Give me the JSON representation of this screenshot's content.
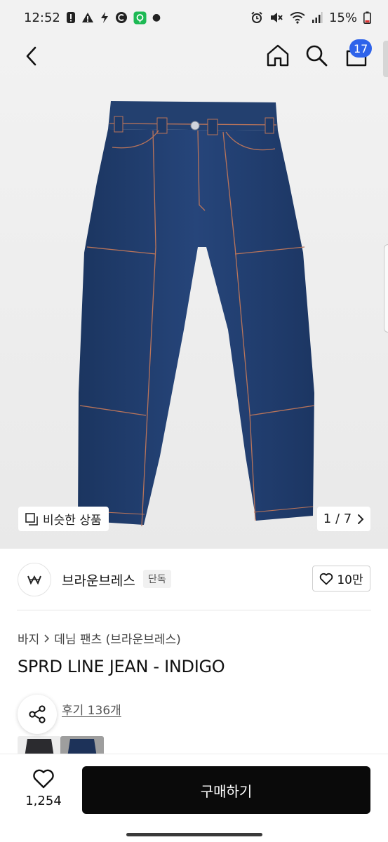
{
  "status_bar": {
    "time": "12:52",
    "battery": "15%"
  },
  "header": {
    "cart_badge": "17",
    "icons": [
      "back-arrow-icon",
      "home-icon",
      "search-icon",
      "shopping-bag-icon"
    ]
  },
  "gallery": {
    "similar_label": "비슷한 상품",
    "pager": "1 / 7"
  },
  "brand": {
    "name": "브라운브레스",
    "tag": "단독",
    "likes": "10만"
  },
  "product": {
    "breadcrumb": [
      "바지",
      "데님 팬츠 (브라운브레스)"
    ],
    "title": "SPRD LINE JEAN - INDIGO",
    "reviews": "후기 136개"
  },
  "bottom_bar": {
    "wish_count": "1,254",
    "buy_label": "구매하기"
  },
  "colors": {
    "badge": "#2e63ea",
    "buy_button": "#0a0a0a",
    "denim": "#213e6e"
  }
}
